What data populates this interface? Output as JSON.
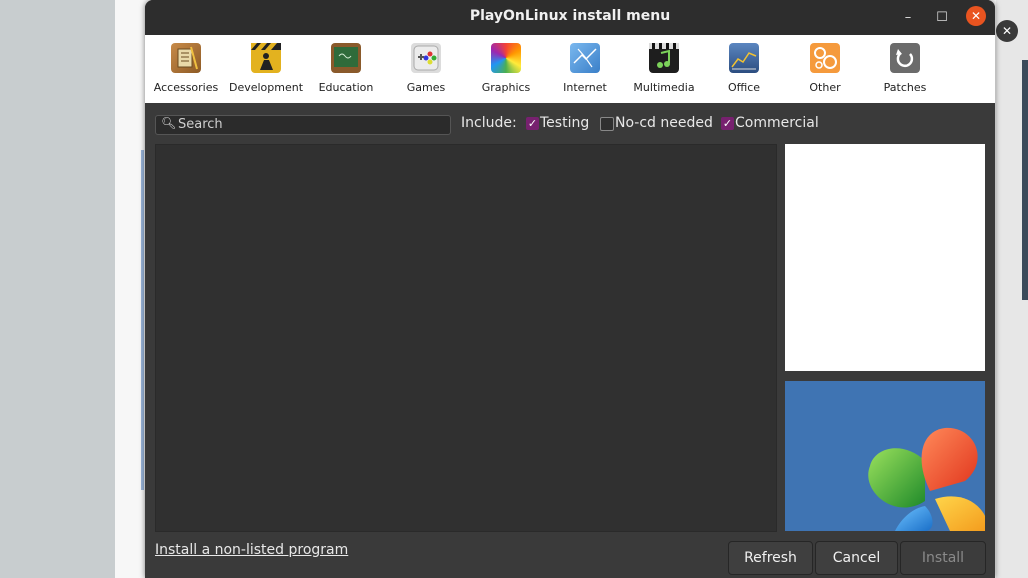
{
  "window": {
    "title": "PlayOnLinux install menu",
    "minimize_glyph": "–",
    "maximize_glyph": "☐",
    "close_glyph": "✕"
  },
  "background": {
    "close_glyph": "✕"
  },
  "categories": [
    {
      "label": "Accessories",
      "icon": "accessories-icon",
      "color": "#b07a3c"
    },
    {
      "label": "Development",
      "icon": "development-icon",
      "color": "#d9a627"
    },
    {
      "label": "Education",
      "icon": "education-icon",
      "color": "#3d7a4a"
    },
    {
      "label": "Games",
      "icon": "games-icon",
      "color": "#d8d8d8"
    },
    {
      "label": "Graphics",
      "icon": "graphics-icon",
      "color": "#e84e3c"
    },
    {
      "label": "Internet",
      "icon": "internet-icon",
      "color": "#4a90d9"
    },
    {
      "label": "Multimedia",
      "icon": "multimedia-icon",
      "color": "#2e7d32"
    },
    {
      "label": "Office",
      "icon": "office-icon",
      "color": "#4a6fa5"
    },
    {
      "label": "Other",
      "icon": "other-icon",
      "color": "#f39a3a"
    },
    {
      "label": "Patches",
      "icon": "patches-icon",
      "color": "#6a6a6a"
    }
  ],
  "filter": {
    "search_placeholder": "Search",
    "include_label": "Include:",
    "options": [
      {
        "label": "Testing",
        "checked": true
      },
      {
        "label": "No-cd needed",
        "checked": false
      },
      {
        "label": "Commercial",
        "checked": true
      }
    ]
  },
  "footer": {
    "nonlisted_link": "Install a non-listed program",
    "refresh_label": "Refresh",
    "cancel_label": "Cancel",
    "install_label": "Install"
  },
  "colors": {
    "accent": "#77216f",
    "close_button": "#e95420"
  }
}
